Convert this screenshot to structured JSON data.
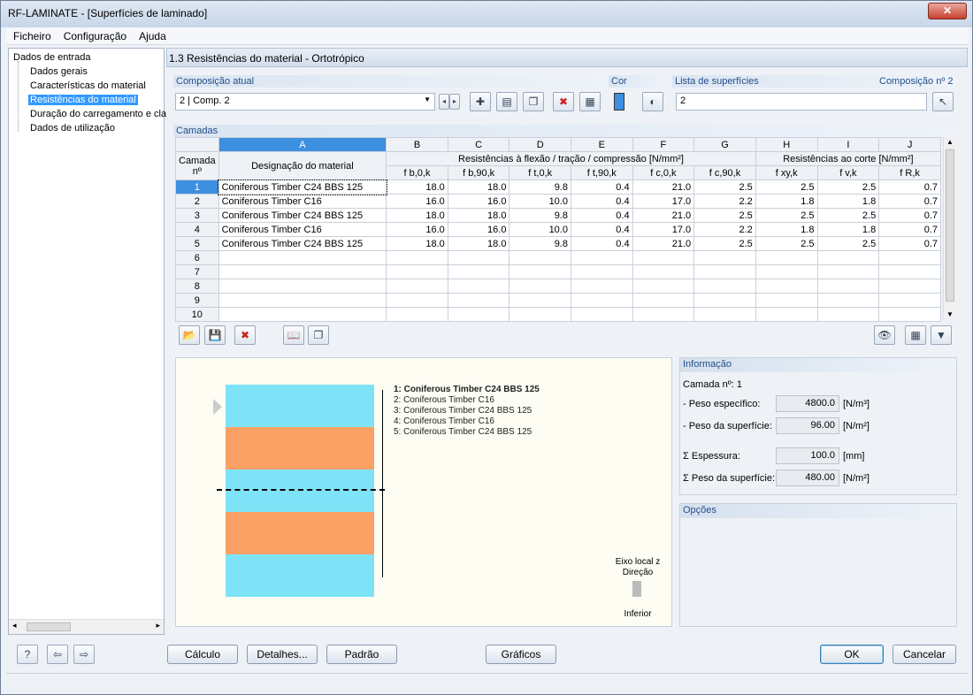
{
  "window": {
    "title": "RF-LAMINATE - [Superfícies de laminado]",
    "close": "✕"
  },
  "menu": [
    "Ficheiro",
    "Configuração",
    "Ajuda"
  ],
  "tree": {
    "root": "Dados de entrada",
    "items": [
      "Dados gerais",
      "Características do material",
      "Resistências do material",
      "Duração do carregamento e cla",
      "Dados de utilização"
    ],
    "selected_index": 2
  },
  "main": {
    "header": "1.3 Resistências do material - Ortotrópico",
    "composicao": {
      "title": "Composição atual",
      "value": "2 | Comp. 2"
    },
    "cor": {
      "title": "Cor",
      "color": "#3d8fe0"
    },
    "lista": {
      "title": "Lista de superfícies",
      "right_title": "Composição nº 2",
      "value": "2"
    },
    "camadas": {
      "title": "Camadas",
      "col_letters": [
        "A",
        "B",
        "C",
        "D",
        "E",
        "F",
        "G",
        "H",
        "I",
        "J"
      ],
      "head_row": "Camada nº",
      "head_A": "Designação do material",
      "group1": "Resistências à flexão / tração / compressão [N/mm²]",
      "group2": "Resistências ao corte [N/mm²]",
      "sub": [
        "f b,0,k",
        "f b,90,k",
        "f t,0,k",
        "f t,90,k",
        "f c,0,k",
        "f c,90,k",
        "f xy,k",
        "f v,k",
        "f R,k"
      ],
      "rows": [
        {
          "n": "1",
          "mat": "Coniferous Timber C24 BBS 125",
          "v": [
            "18.0",
            "18.0",
            "9.8",
            "0.4",
            "21.0",
            "2.5",
            "2.5",
            "2.5",
            "0.7"
          ]
        },
        {
          "n": "2",
          "mat": "Coniferous Timber C16",
          "v": [
            "16.0",
            "16.0",
            "10.0",
            "0.4",
            "17.0",
            "2.2",
            "1.8",
            "1.8",
            "0.7"
          ]
        },
        {
          "n": "3",
          "mat": "Coniferous Timber C24 BBS 125",
          "v": [
            "18.0",
            "18.0",
            "9.8",
            "0.4",
            "21.0",
            "2.5",
            "2.5",
            "2.5",
            "0.7"
          ]
        },
        {
          "n": "4",
          "mat": "Coniferous Timber C16",
          "v": [
            "16.0",
            "16.0",
            "10.0",
            "0.4",
            "17.0",
            "2.2",
            "1.8",
            "1.8",
            "0.7"
          ]
        },
        {
          "n": "5",
          "mat": "Coniferous Timber C24 BBS 125",
          "v": [
            "18.0",
            "18.0",
            "9.8",
            "0.4",
            "21.0",
            "2.5",
            "2.5",
            "2.5",
            "0.7"
          ]
        },
        {
          "n": "6",
          "mat": "",
          "v": [
            "",
            "",
            "",
            "",
            "",
            "",
            "",
            "",
            ""
          ]
        },
        {
          "n": "7",
          "mat": "",
          "v": [
            "",
            "",
            "",
            "",
            "",
            "",
            "",
            "",
            ""
          ]
        },
        {
          "n": "8",
          "mat": "",
          "v": [
            "",
            "",
            "",
            "",
            "",
            "",
            "",
            "",
            ""
          ]
        },
        {
          "n": "9",
          "mat": "",
          "v": [
            "",
            "",
            "",
            "",
            "",
            "",
            "",
            "",
            ""
          ]
        },
        {
          "n": "10",
          "mat": "",
          "v": [
            "",
            "",
            "",
            "",
            "",
            "",
            "",
            "",
            ""
          ]
        }
      ]
    },
    "drawing": {
      "labels": [
        "1: Coniferous Timber C24 BBS 125",
        "2: Coniferous Timber C16",
        "3: Coniferous Timber C24 BBS 125",
        "4: Coniferous Timber C16",
        "5: Coniferous Timber C24 BBS 125"
      ],
      "axis_label": "Eixo local z",
      "direction_label": "Direção",
      "bottom_label": "Inferior",
      "colors": {
        "c24": "#7fe3f7",
        "c16": "#f9a064"
      }
    },
    "info": {
      "title": "Informação",
      "camada": "Camada nº: 1",
      "peso_esp_label": "- Peso específico:",
      "peso_esp": "4800.0",
      "peso_esp_unit": "[N/m³]",
      "peso_sup_label": "- Peso da superfície:",
      "peso_sup": "96.00",
      "peso_sup_unit": "[N/m²]",
      "esp_label": "Σ Espessura:",
      "esp": "100.0",
      "esp_unit": "[mm]",
      "peso_tot_label": "Σ Peso da superfície:",
      "peso_tot": "480.00",
      "peso_tot_unit": "[N/m²]"
    },
    "opcoes": {
      "title": "Opções"
    }
  },
  "buttons": {
    "calculo": "Cálculo",
    "detalhes": "Detalhes...",
    "padrao": "Padrão",
    "graficos": "Gráficos",
    "ok": "OK",
    "cancelar": "Cancelar"
  }
}
